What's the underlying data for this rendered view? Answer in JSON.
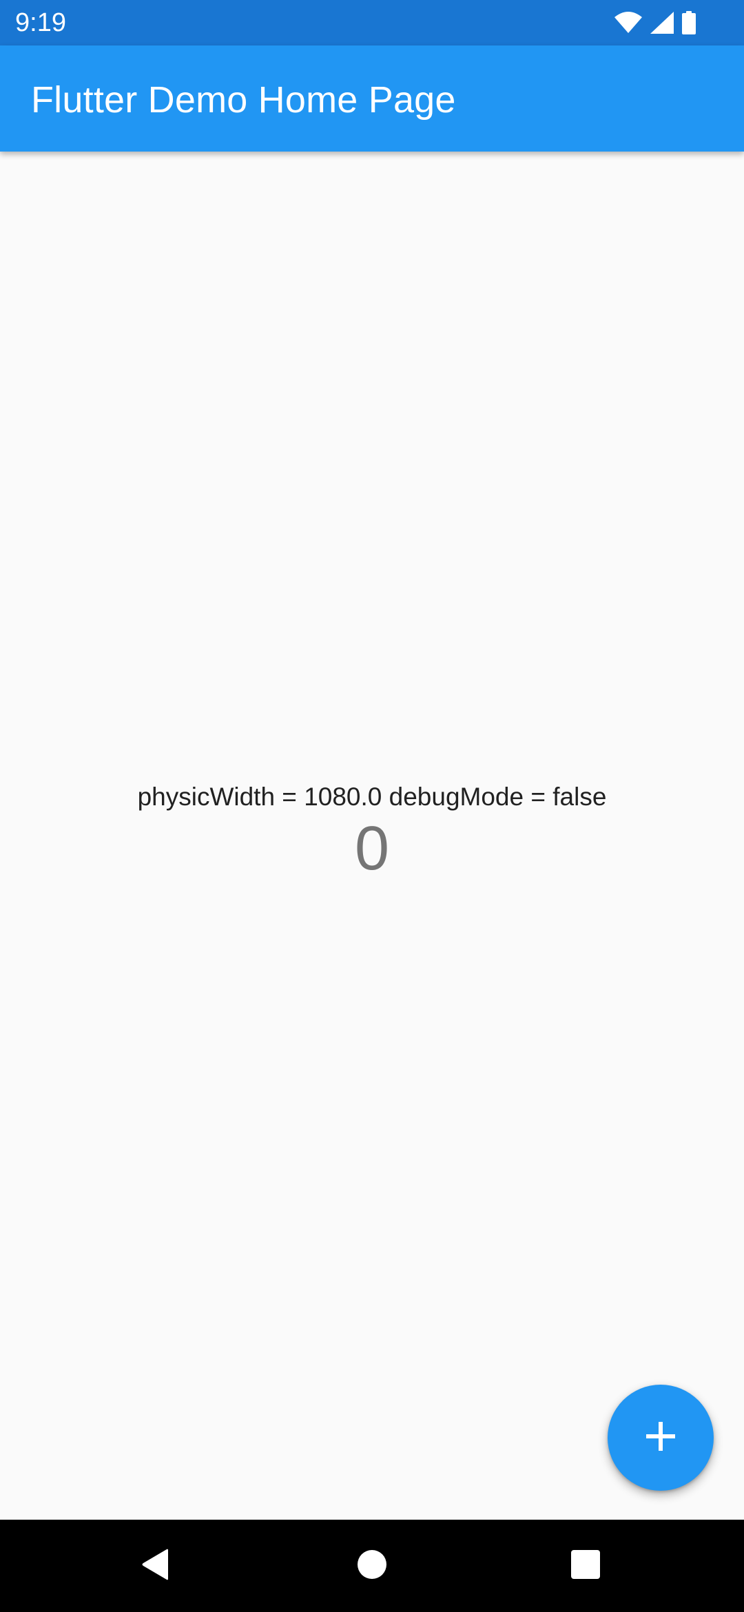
{
  "status_bar": {
    "time": "9:19",
    "icons": [
      "wifi-icon",
      "cell-signal-icon",
      "battery-icon"
    ]
  },
  "app_bar": {
    "title": "Flutter Demo Home Page"
  },
  "main": {
    "info_text": "physicWidth = 1080.0 debugMode = false",
    "counter": "0"
  },
  "fab": {
    "icon": "add-icon"
  },
  "nav_bar": {
    "buttons": [
      "back-icon",
      "home-icon",
      "recents-icon"
    ]
  },
  "colors": {
    "status_bar": "#1976d2",
    "primary": "#2196f3",
    "background": "#fafafa",
    "nav_bar": "#000000"
  }
}
